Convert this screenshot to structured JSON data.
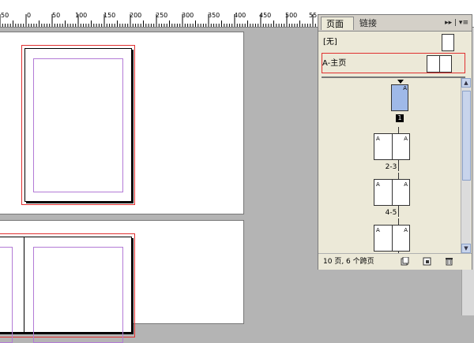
{
  "ruler": {
    "labels": [
      "50",
      "0",
      "50",
      "100",
      "150",
      "200",
      "250",
      "300",
      "350",
      "400",
      "450",
      "500",
      "55"
    ]
  },
  "panel": {
    "tabs": {
      "pages": "页面",
      "links": "链接"
    },
    "menu_glyphs": "▸▸ | ▾≡",
    "masters": {
      "none": "[无]",
      "a_master": "A-主页"
    },
    "page_labels": {
      "p1": "1",
      "p23": "2-3",
      "p45": "4-5"
    },
    "thumb_marker": "A",
    "footer": {
      "status": "10 页, 6 个跨页"
    }
  },
  "colors": {
    "bleed": "#e03030",
    "margin": "#b37bd6",
    "selected_page": "#9fb9e8"
  }
}
